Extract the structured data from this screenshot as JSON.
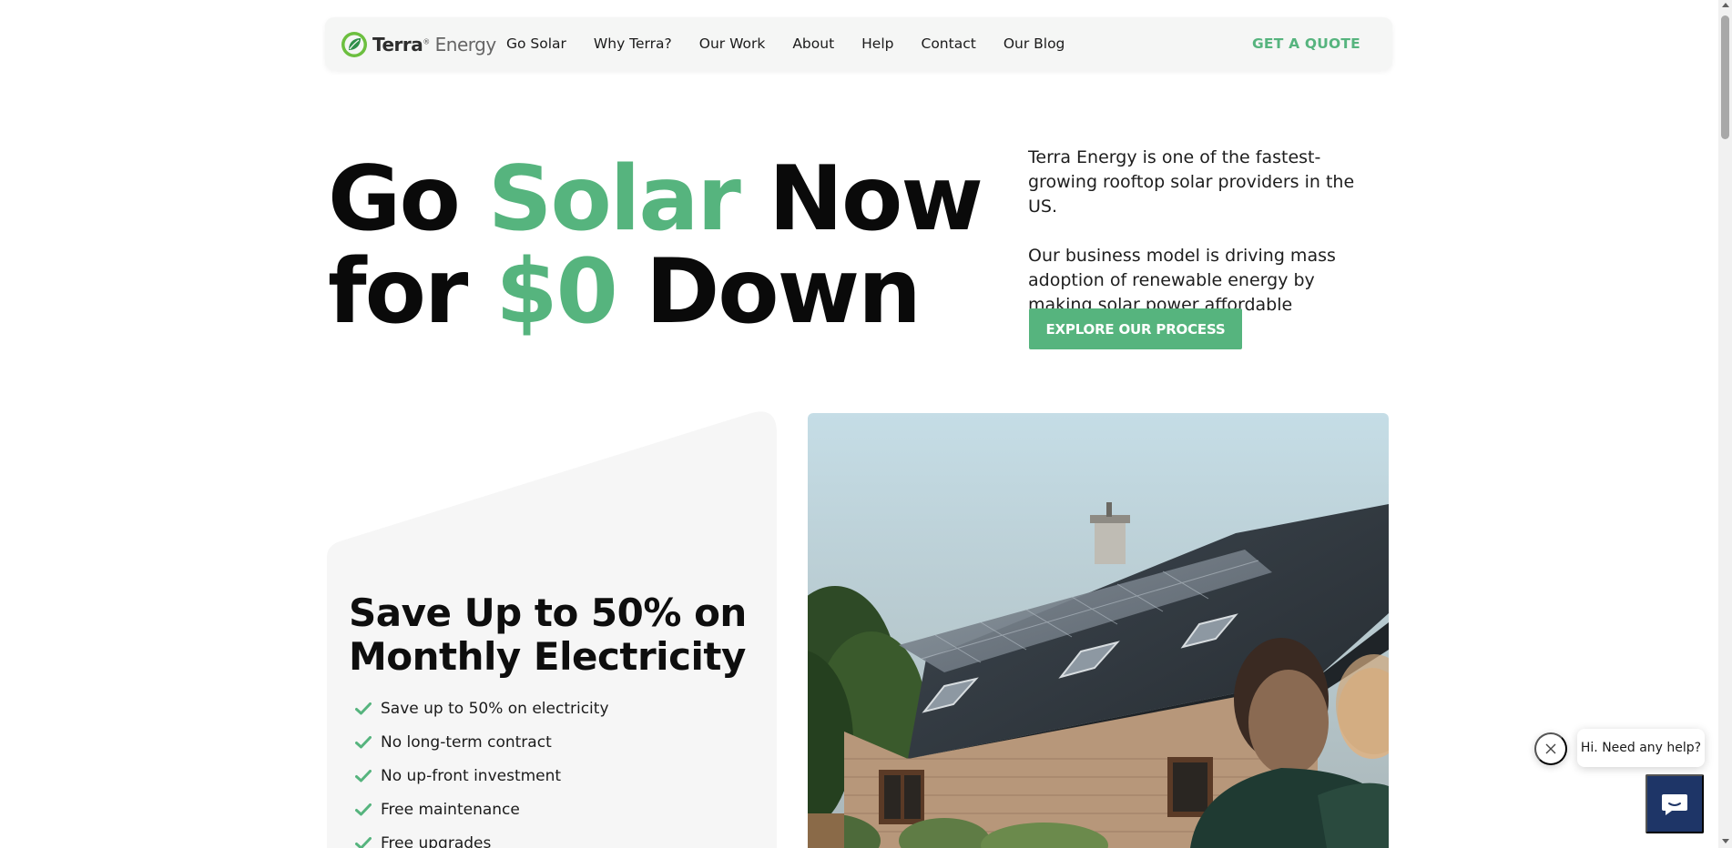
{
  "brand": {
    "name_bold": "Terra",
    "name_light": "Energy",
    "reg_mark": "®",
    "accent": "#56b47e",
    "chat_color": "#1e3567"
  },
  "nav": {
    "items": [
      {
        "label": "Go Solar"
      },
      {
        "label": "Why Terra?"
      },
      {
        "label": "Our Work"
      },
      {
        "label": "About"
      },
      {
        "label": "Help"
      },
      {
        "label": "Contact"
      },
      {
        "label": "Our Blog"
      }
    ],
    "cta": "GET A QUOTE"
  },
  "hero": {
    "line1": {
      "a": "Go",
      "b": "Solar",
      "c": "Now"
    },
    "line2": {
      "a": "for",
      "b": "$0",
      "c": "Down"
    },
    "paragraph1": "Terra Energy is one of the fastest-growing rooftop solar providers in the US.",
    "paragraph2": "Our business model is driving mass adoption of renewable energy by making solar power affordable",
    "button": "EXPLORE OUR PROCESS"
  },
  "savings": {
    "title": "Save Up to 50% on Monthly Electricity",
    "benefits": [
      {
        "text": "Save up to 50% on electricity"
      },
      {
        "text": "No long-term contract"
      },
      {
        "text": "No up-front investment"
      },
      {
        "text": "Free maintenance"
      },
      {
        "text": "Free upgrades"
      }
    ]
  },
  "chat": {
    "greeting": "Hi. Need any help?"
  },
  "icons": {
    "close": "close-icon",
    "chat": "chat-icon",
    "check": "check-icon",
    "logo": "leaf-logo-icon"
  }
}
